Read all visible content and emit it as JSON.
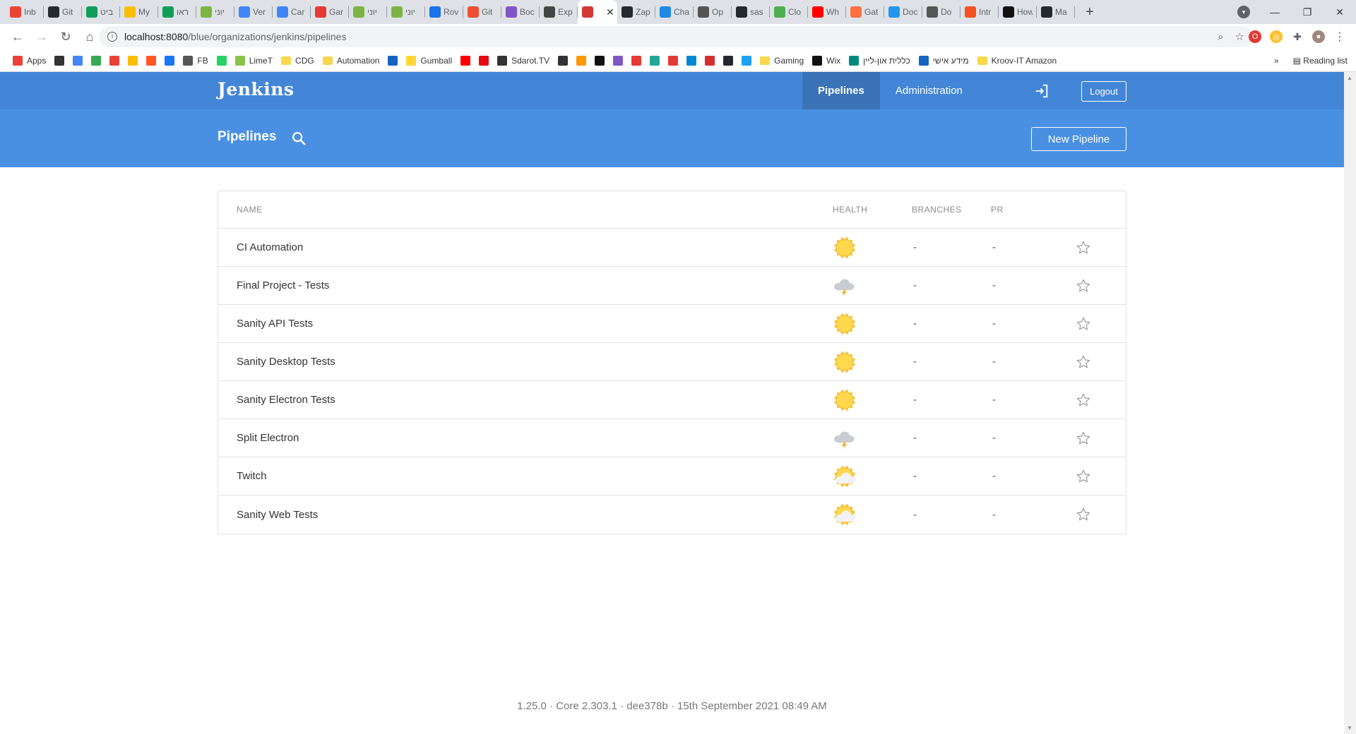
{
  "browser": {
    "tabs": [
      {
        "title": "Inb",
        "icon": "gmail-icon",
        "color": "#ea4335"
      },
      {
        "title": "Git",
        "icon": "git-icon",
        "color": "#24292e"
      },
      {
        "title": "ביט",
        "icon": "edge-icon",
        "color": "#0f9d58"
      },
      {
        "title": "My",
        "icon": "drive-icon",
        "color": "#fbbc04"
      },
      {
        "title": "ראו",
        "icon": "sheets-icon",
        "color": "#0f9d58"
      },
      {
        "title": "יוני",
        "icon": "leaf-icon",
        "color": "#7cb342"
      },
      {
        "title": "Ver",
        "icon": "docs-icon",
        "color": "#4285f4"
      },
      {
        "title": "Car",
        "icon": "docs-icon",
        "color": "#4285f4"
      },
      {
        "title": "Gar",
        "icon": "circle-icon",
        "color": "#e53935"
      },
      {
        "title": "יוני",
        "icon": "leaf-icon",
        "color": "#7cb342"
      },
      {
        "title": "יוני",
        "icon": "leaf-icon",
        "color": "#7cb342"
      },
      {
        "title": "Rov",
        "icon": "c-icon",
        "color": "#1a73e8"
      },
      {
        "title": "Git",
        "icon": "git-diamond-icon",
        "color": "#f05032"
      },
      {
        "title": "Boc",
        "icon": "b-icon",
        "color": "#7e57c2"
      },
      {
        "title": "Exp",
        "icon": "wand-icon",
        "color": "#444444"
      },
      {
        "title": "",
        "icon": "jenkins-icon",
        "color": "#d33833"
      },
      {
        "title": "Zap",
        "icon": "github-icon",
        "color": "#24292e"
      },
      {
        "title": "Cha",
        "icon": "bolt-icon",
        "color": "#1e88e5"
      },
      {
        "title": "Op",
        "icon": "folder-icon",
        "color": "#555555"
      },
      {
        "title": "sas",
        "icon": "github-icon",
        "color": "#24292e"
      },
      {
        "title": "Clo",
        "icon": "mongo-icon",
        "color": "#4caf50"
      },
      {
        "title": "Wh",
        "icon": "youtube-icon",
        "color": "#ff0000"
      },
      {
        "title": "Gat",
        "icon": "infinity-icon",
        "color": "#ff7043"
      },
      {
        "title": "Doc",
        "icon": "docker-icon",
        "color": "#2496ed"
      },
      {
        "title": "Do",
        "icon": "circle-icon",
        "color": "#555555"
      },
      {
        "title": "Intr",
        "icon": "circle-icon",
        "color": "#f4511e"
      },
      {
        "title": "How",
        "icon": "box-icon",
        "color": "#111111"
      },
      {
        "title": "Ma",
        "icon": "github-icon",
        "color": "#24292e"
      }
    ],
    "active_tab_index": 15,
    "url_host": "localhost:8080",
    "url_path": "/blue/organizations/jenkins/pipelines",
    "bookmarks": [
      {
        "label": "Apps",
        "color": "#ea4335"
      },
      {
        "label": "",
        "color": "#333333"
      },
      {
        "label": "",
        "color": "#4285f4"
      },
      {
        "label": "",
        "color": "#34a853"
      },
      {
        "label": "",
        "color": "#ea4335"
      },
      {
        "label": "",
        "color": "#fbbc04"
      },
      {
        "label": "",
        "color": "#ff5722"
      },
      {
        "label": "",
        "color": "#1877f2"
      },
      {
        "label": "FB",
        "color": "#555555"
      },
      {
        "label": "",
        "color": "#25d366"
      },
      {
        "label": "LimeT",
        "color": "#8bc34a"
      },
      {
        "label": "CDG",
        "folder": true
      },
      {
        "label": "Automation",
        "folder": true
      },
      {
        "label": "",
        "color": "#1565c0"
      },
      {
        "label": "Gumball",
        "color": "#fdd835"
      },
      {
        "label": "",
        "color": "#ff0000"
      },
      {
        "label": "",
        "color": "#e50914"
      },
      {
        "label": "Sdarot.TV",
        "color": "#333333"
      },
      {
        "label": "",
        "color": "#333333"
      },
      {
        "label": "",
        "color": "#ff9900"
      },
      {
        "label": "",
        "color": "#111111"
      },
      {
        "label": "",
        "color": "#7e57c2"
      },
      {
        "label": "",
        "color": "#e53935"
      },
      {
        "label": "",
        "color": "#26a69a"
      },
      {
        "label": "",
        "color": "#e53935"
      },
      {
        "label": "",
        "color": "#0288d1"
      },
      {
        "label": "",
        "color": "#d32f2f"
      },
      {
        "label": "",
        "color": "#24292e"
      },
      {
        "label": "",
        "color": "#1da1f2"
      },
      {
        "label": "Gaming",
        "folder": true
      },
      {
        "label": "Wix",
        "color": "#111111"
      },
      {
        "label": "כללית און-ליין",
        "color": "#00897b"
      },
      {
        "label": "מידע אישי",
        "color": "#1565c0"
      },
      {
        "label": "Kroov-IT Amazon",
        "folder": true
      }
    ],
    "bookmarks_more": "»",
    "reading_list": "Reading list"
  },
  "jenkins": {
    "brand": "Jenkins",
    "nav": {
      "pipelines": "Pipelines",
      "administration": "Administration",
      "logout": "Logout"
    },
    "sub_title": "Pipelines",
    "new_pipeline": "New Pipeline",
    "columns": {
      "name": "NAME",
      "health": "HEALTH",
      "branches": "BRANCHES",
      "pr": "PR"
    },
    "pipelines": [
      {
        "name": "CI Automation",
        "health": "sunny",
        "branches": "-",
        "pr": "-"
      },
      {
        "name": "Final Project - Tests",
        "health": "stormy",
        "branches": "-",
        "pr": "-"
      },
      {
        "name": "Sanity API Tests",
        "health": "sunny",
        "branches": "-",
        "pr": "-"
      },
      {
        "name": "Sanity Desktop Tests",
        "health": "sunny",
        "branches": "-",
        "pr": "-"
      },
      {
        "name": "Sanity Electron Tests",
        "health": "sunny",
        "branches": "-",
        "pr": "-"
      },
      {
        "name": "Split Electron",
        "health": "stormy",
        "branches": "-",
        "pr": "-"
      },
      {
        "name": "Twitch",
        "health": "partly-sunny",
        "branches": "-",
        "pr": "-"
      },
      {
        "name": "Sanity Web Tests",
        "health": "partly-sunny",
        "branches": "-",
        "pr": "-"
      }
    ],
    "footer": "1.25.0 · Core 2.303.1 · dee378b · 15th September 2021 08:49 AM"
  },
  "colors": {
    "topbar": "#4386d7",
    "subbar": "#4a90e2",
    "nav_active": "#3a73b7"
  }
}
